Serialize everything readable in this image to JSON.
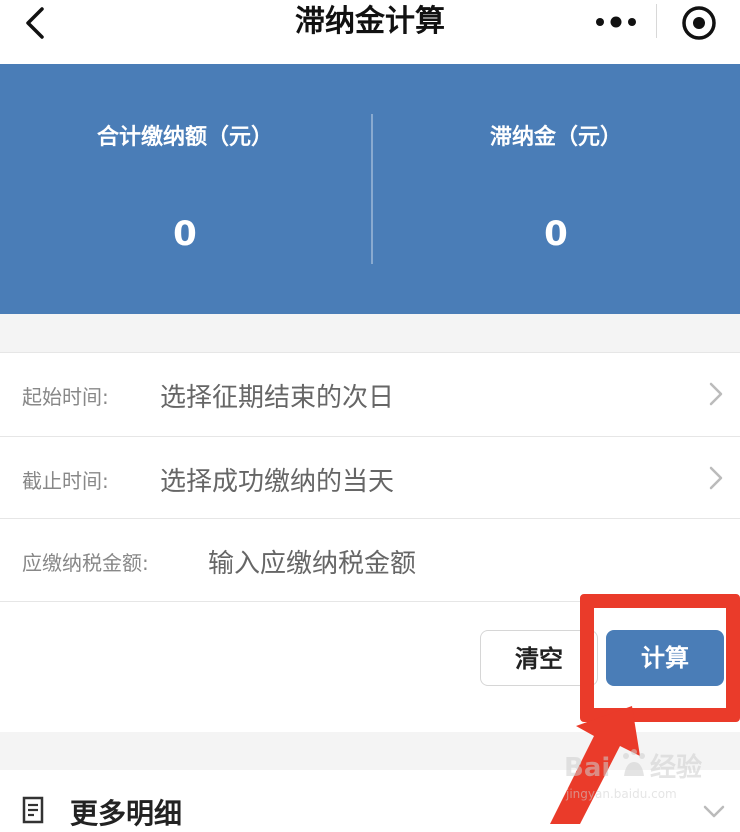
{
  "header": {
    "title": "滞纳金计算"
  },
  "summary": {
    "total_label": "合计缴纳额（元）",
    "total_value": "0",
    "late_fee_label": "滞纳金（元）",
    "late_fee_value": "0"
  },
  "form": {
    "start": {
      "label": "起始时间:",
      "value": "选择征期结束的次日"
    },
    "end": {
      "label": "截止时间:",
      "value": "选择成功缴纳的当天"
    },
    "amount": {
      "label": "应缴纳税金额:",
      "placeholder": "输入应缴纳税金额"
    }
  },
  "buttons": {
    "clear": "清空",
    "calculate": "计算"
  },
  "details": {
    "label": "更多明细"
  },
  "watermark": {
    "brand": "Bai",
    "brand2": "经验",
    "url": "jingyan.baidu.com"
  },
  "colors": {
    "primary": "#4a7db7",
    "highlight": "#ea3b2a"
  }
}
